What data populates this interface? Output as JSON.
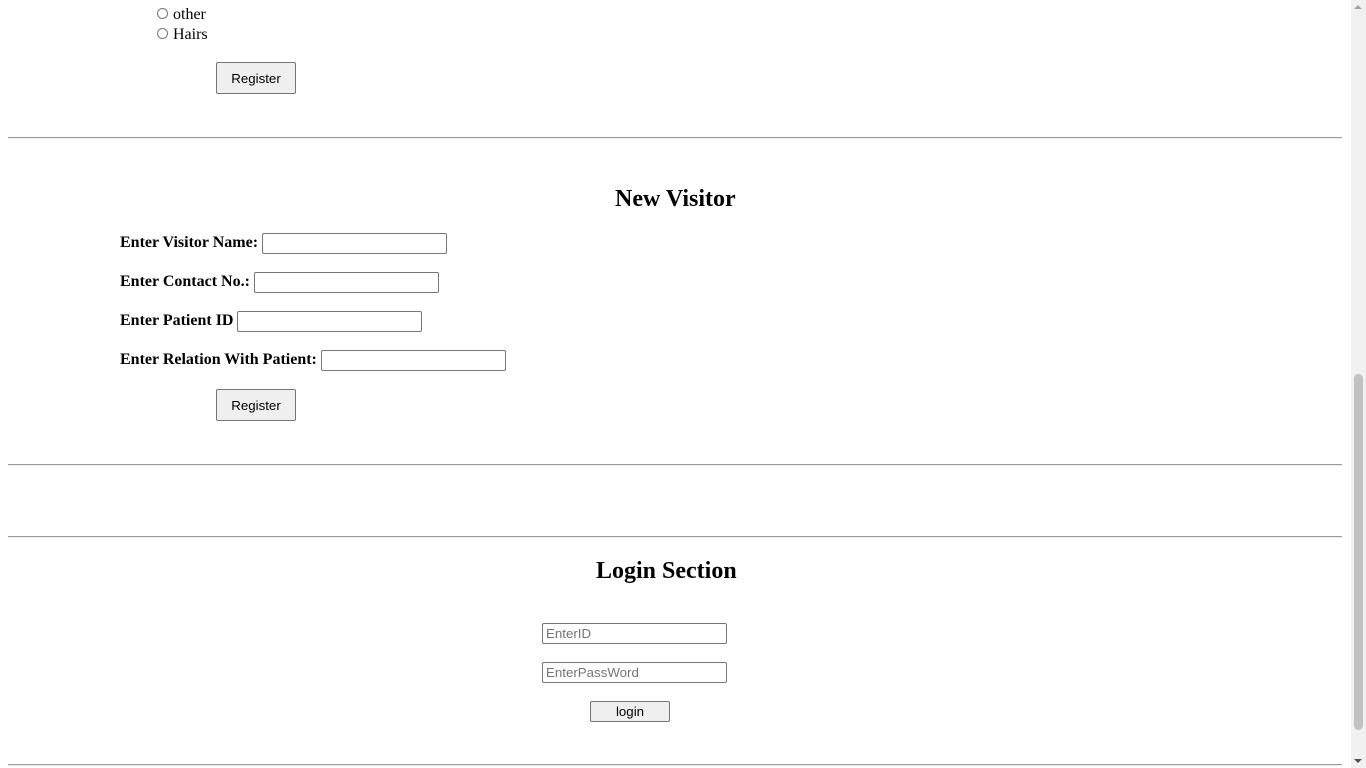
{
  "gender_options": [
    {
      "label": "other"
    },
    {
      "label": "Hairs"
    }
  ],
  "patient_form": {
    "register_label": "Register"
  },
  "visitor_form": {
    "heading": "New Visitor",
    "name_label": "Enter Visitor Name:",
    "contact_label": "Enter Contact No.:",
    "patient_id_label": "Enter Patient ID",
    "relation_label": "Enter Relation With Patient:",
    "register_label": "Register"
  },
  "login": {
    "heading": "Login Section",
    "id_placeholder": "EnterID",
    "password_placeholder": "EnterPassWord",
    "button_label": "login"
  }
}
